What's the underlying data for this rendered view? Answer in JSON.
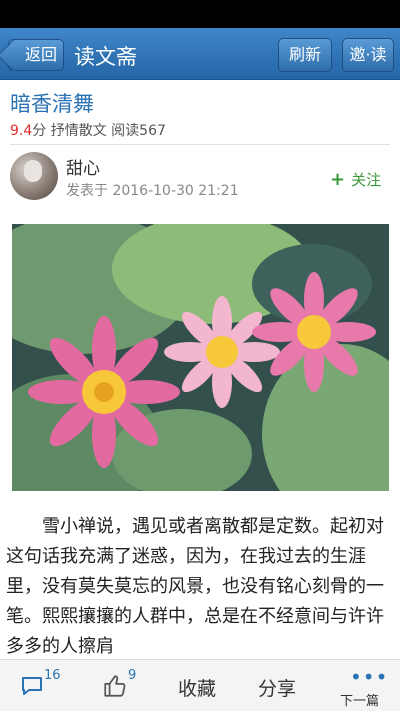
{
  "header": {
    "back_label": "返回",
    "title": "读文斋",
    "refresh_label": "刷新",
    "invite_label": "邀·读"
  },
  "article": {
    "title": "暗香清舞",
    "score": "9.4",
    "score_unit": "分",
    "category": "抒情散文",
    "reads": "阅读567",
    "author": "甜心",
    "published": "发表于 2016-10-30 21:21",
    "follow_label": "关注",
    "body": "雪小禅说，遇见或者离散都是定数。起初对这句话我充满了迷惑，因为，在我过去的生涯里，没有莫失莫忘的风景，也没有铭心刻骨的一笔。熙熙攘攘的人群中，总是在不经意间与许许多多的人擦肩"
  },
  "bottom": {
    "comment_count": "16",
    "like_count": "9",
    "favorite_label": "收藏",
    "share_label": "分享",
    "next_label": "下一篇"
  },
  "colors": {
    "header_blue": "#2f74b8",
    "title_blue": "#2a73b5",
    "score_red": "#e02a2a",
    "follow_green": "#3a9a3a"
  }
}
